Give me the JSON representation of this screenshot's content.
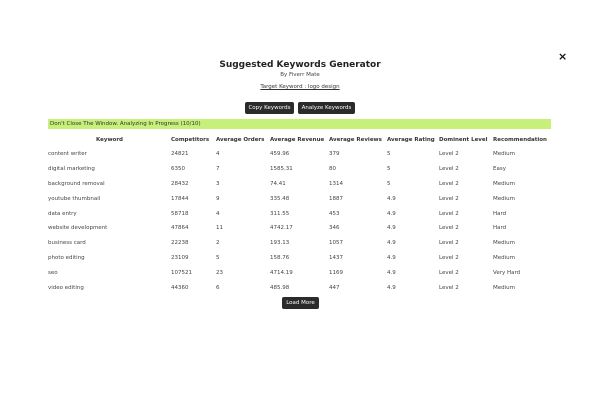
{
  "modal": {
    "title": "Suggested Keywords Generator",
    "subtitle": "By Fiverr Mate",
    "target": "Target Keyword : logo design",
    "copy_label": "Copy Keywords",
    "analyze_label": "Analyze Keywords",
    "close_label": "×",
    "banner": "Don't Close The Window. Analyzing In Progress (10/10)",
    "load_more_label": "Load More"
  },
  "table": {
    "headers": [
      "Keyword",
      "Competitors",
      "Average Orders",
      "Average Revenue",
      "Average Reviews",
      "Average Rating",
      "Dominent Level",
      "Recommendation"
    ],
    "rows": [
      [
        "content writer",
        "24821",
        "4",
        "459.96",
        "379",
        "5",
        "Level 2",
        "Medium"
      ],
      [
        "digital marketing",
        "6350",
        "7",
        "1585.31",
        "80",
        "5",
        "Level 2",
        "Easy"
      ],
      [
        "background removal",
        "28432",
        "3",
        "74.41",
        "1314",
        "5",
        "Level 2",
        "Medium"
      ],
      [
        "youtube thumbnail",
        "17844",
        "9",
        "335.48",
        "1887",
        "4.9",
        "Level 2",
        "Medium"
      ],
      [
        "data entry",
        "58718",
        "4",
        "311.55",
        "453",
        "4.9",
        "Level 2",
        "Hard"
      ],
      [
        "website development",
        "47864",
        "11",
        "4742.17",
        "346",
        "4.9",
        "Level 2",
        "Hard"
      ],
      [
        "business card",
        "22238",
        "2",
        "193.13",
        "1057",
        "4.9",
        "Level 2",
        "Medium"
      ],
      [
        "photo editing",
        "23109",
        "5",
        "158.76",
        "1437",
        "4.9",
        "Level 2",
        "Medium"
      ],
      [
        "seo",
        "107521",
        "23",
        "4714.19",
        "1169",
        "4.9",
        "Level 2",
        "Very Hard"
      ],
      [
        "video editing",
        "44360",
        "6",
        "485.98",
        "447",
        "4.9",
        "Level 2",
        "Medium"
      ]
    ]
  },
  "colors": {
    "banner_bg": "#c6f07a",
    "button_bg": "#2b2b2b"
  }
}
